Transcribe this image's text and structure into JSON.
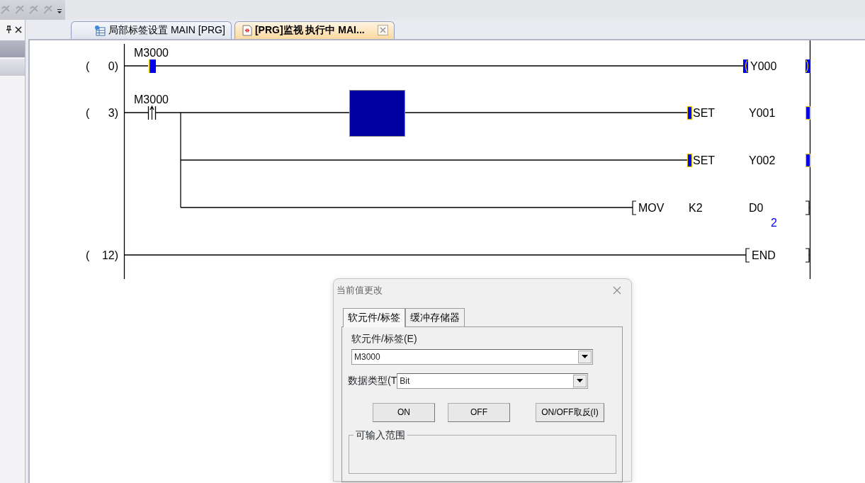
{
  "tabs": [
    {
      "label": "局部标签设置 MAIN [PRG]",
      "selected": false,
      "kind": "table"
    },
    {
      "label": "[PRG]监视 执行中 MAI...",
      "selected": true,
      "kind": "program"
    }
  ],
  "ladder": {
    "cursor": true,
    "steps": [
      {
        "open": "(",
        "number": "0)",
        "lines": [
          {
            "contact": {
              "kind": "normal",
              "device": "M3000",
              "on": true
            },
            "output": {
              "kind": "coil",
              "operands": [
                "Y000"
              ],
              "on": true
            }
          }
        ]
      },
      {
        "open": "(",
        "number": "3)",
        "lines": [
          {
            "contact": {
              "kind": "rising",
              "device": "M3000",
              "on": false
            },
            "output": {
              "kind": "set",
              "instruction": "SET",
              "operands": [
                "Y001"
              ],
              "on": true
            }
          },
          {
            "output": {
              "kind": "set",
              "instruction": "SET",
              "operands": [
                "Y002"
              ],
              "on": true
            }
          },
          {
            "output": {
              "kind": "apply",
              "instruction": "MOV",
              "operands": [
                "K2",
                "D0"
              ],
              "on": false,
              "monitor": "2"
            }
          }
        ]
      },
      {
        "open": "(",
        "number": "12)",
        "lines": [
          {
            "output": {
              "kind": "end",
              "instruction": "END",
              "on": false
            }
          }
        ]
      }
    ]
  },
  "dialog": {
    "title": "当前值更改",
    "tabs": [
      {
        "label": "软元件/标签",
        "selected": true
      },
      {
        "label": "缓冲存储器",
        "selected": false
      }
    ],
    "device_label": "软元件/标签(E)",
    "device_value": "M3000",
    "type_label": "数据类型(T",
    "type_value": "Bit",
    "buttons": [
      "ON",
      "OFF",
      "ON/OFF取反(I)"
    ],
    "range_group": "可输入范围"
  }
}
